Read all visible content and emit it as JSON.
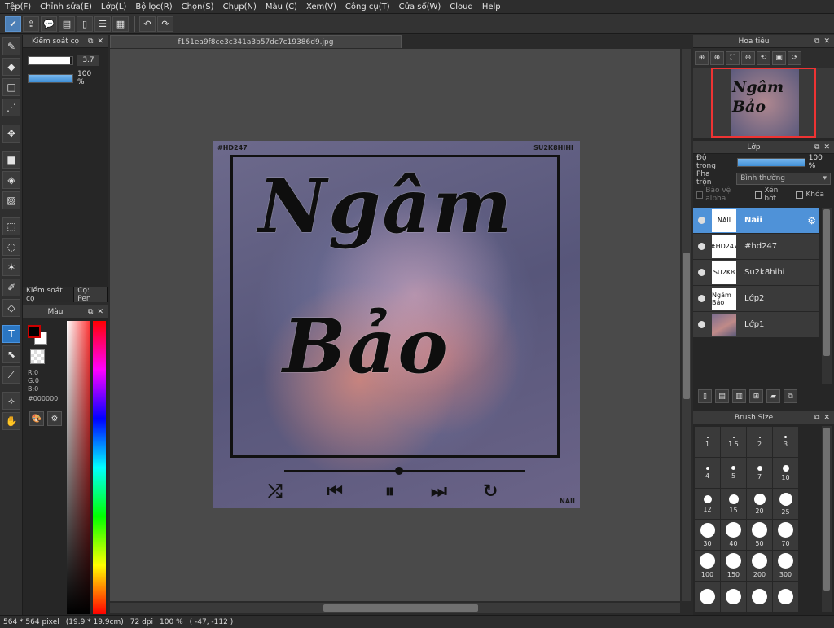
{
  "menu": [
    "Tệp(F)",
    "Chỉnh sửa(E)",
    "Lớp(L)",
    "Bộ lọc(R)",
    "Chọn(S)",
    "Chụp(N)",
    "Màu (C)",
    "Xem(V)",
    "Công cụ(T)",
    "Cửa sổ(W)",
    "Cloud",
    "Help"
  ],
  "toolbar": {
    "icons": [
      "check-icon",
      "share-icon",
      "speech-icon",
      "comment-icon",
      "page-icon",
      "list-icon",
      "grid-icon"
    ],
    "undo_icon": "undo-icon",
    "redo_icon": "redo-icon"
  },
  "brush_panel": {
    "title": "Kiểm soát cọ",
    "size_value": "3.7",
    "size_fraction": 0.95,
    "opacity_value": "100 %",
    "opacity_fraction": 1.0
  },
  "panel_tabs": [
    "Kiểm soát cọ",
    "Cọ: Pen"
  ],
  "color_panel": {
    "title": "Màu",
    "r": "R:0",
    "g": "G:0",
    "b": "B:0",
    "hex": "#000000",
    "foreground": "#000000",
    "background": "#ffffff"
  },
  "document": {
    "filename": "f151ea9f8ce3c341a3b57dc7c19386d9.jpg",
    "artwork": {
      "tag_left": "#HD247",
      "tag_right": "SU2K8HIHI",
      "title_line1": "Ngâm",
      "title_line2": "Bảo",
      "signature": "NAII"
    }
  },
  "navigator": {
    "title": "Hoa tiêu",
    "tools": [
      "zoom-in-icon",
      "zoom-in-icon",
      "fit-icon",
      "zoom-out-icon",
      "rotate-left-icon",
      "fit-screen-icon",
      "rotate-right-icon"
    ]
  },
  "layers_panel": {
    "title": "Lớp",
    "opacity_label": "Độ trong",
    "opacity_value": "100 %",
    "blend_label": "Pha trộn",
    "blend_value": "Bình thường",
    "protect_alpha": "Bảo vệ alpha",
    "clipping": "Xén bớt",
    "lock": "Khóa",
    "layers": [
      {
        "name": "Naii",
        "thumb": "NAII",
        "selected": true
      },
      {
        "name": "#hd247",
        "thumb": "#HD247",
        "selected": false
      },
      {
        "name": "Su2k8hihi",
        "thumb": "SU2K8",
        "selected": false
      },
      {
        "name": "Lớp2",
        "thumb": "Ngâm Bảo",
        "selected": false
      },
      {
        "name": "Lớp1",
        "thumb": "",
        "selected": false
      }
    ]
  },
  "brush_size": {
    "title": "Brush Size",
    "sizes": [
      "1",
      "1.5",
      "2",
      "3",
      "4",
      "5",
      "7",
      "10",
      "12",
      "15",
      "20",
      "25",
      "30",
      "40",
      "50",
      "70",
      "100",
      "150",
      "200",
      "300",
      "",
      "",
      "",
      ""
    ]
  },
  "status": {
    "size": "564 * 564 pixel",
    "cm": "(19.9 * 19.9cm)",
    "dpi": "72 dpi",
    "zoom": "100 %",
    "coords": "( -47, -112 )"
  }
}
